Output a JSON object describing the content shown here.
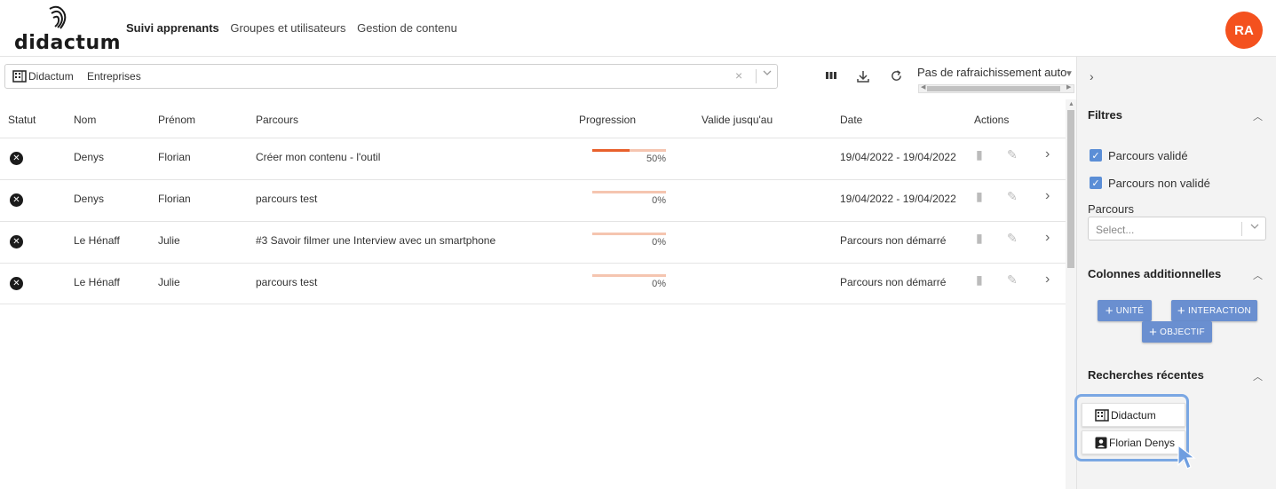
{
  "logo": {
    "text": "didactum"
  },
  "nav": {
    "items": [
      "Suivi apprenants",
      "Groupes et utilisateurs",
      "Gestion de contenu"
    ]
  },
  "user": {
    "initials": "RA",
    "color": "#f4511e"
  },
  "search": {
    "chips": [
      "Didactum",
      "Entreprises"
    ],
    "clear": "×",
    "dropdown": "⌵"
  },
  "toolbar": {
    "refresh_option": "Pas de rafraichissement auto",
    "icons": [
      "columns-icon",
      "download-icon",
      "refresh-icon"
    ]
  },
  "table": {
    "headers": [
      "Statut",
      "Nom",
      "Prénom",
      "Parcours",
      "Progression",
      "Valide jusqu'au",
      "Date",
      "Actions"
    ],
    "rows": [
      {
        "nom": "Denys",
        "prenom": "Florian",
        "parcours": "Créer mon contenu - l'outil",
        "progress": 50,
        "progress_label": "50%",
        "valide": "",
        "date": "19/04/2022 - 19/04/2022"
      },
      {
        "nom": "Denys",
        "prenom": "Florian",
        "parcours": "parcours test",
        "progress": 0,
        "progress_label": "0%",
        "valide": "",
        "date": "19/04/2022 - 19/04/2022"
      },
      {
        "nom": "Le Hénaff",
        "prenom": "Julie",
        "parcours": "#3 Savoir filmer une Interview avec un smartphone",
        "progress": 0,
        "progress_label": "0%",
        "valide": "",
        "date": "Parcours non démarré"
      },
      {
        "nom": "Le Hénaff",
        "prenom": "Julie",
        "parcours": "parcours test",
        "progress": 0,
        "progress_label": "0%",
        "valide": "",
        "date": "Parcours non démarré"
      }
    ]
  },
  "panel": {
    "filters_title": "Filtres",
    "checkboxes": [
      "Parcours validé",
      "Parcours non validé"
    ],
    "parcours_label": "Parcours",
    "parcours_placeholder": "Select...",
    "columns_title": "Colonnes additionnelles",
    "add_buttons": [
      "UNITÉ",
      "INTERACTION",
      "OBJECTIF"
    ],
    "recent_title": "Recherches récentes",
    "recent_items": [
      "Didactum",
      "Florian Denys"
    ]
  },
  "colors": {
    "accent": "#e8602c",
    "button": "#6a8fd0",
    "checkbox": "#5b8ed6",
    "highlight": "#7aa7e3"
  }
}
